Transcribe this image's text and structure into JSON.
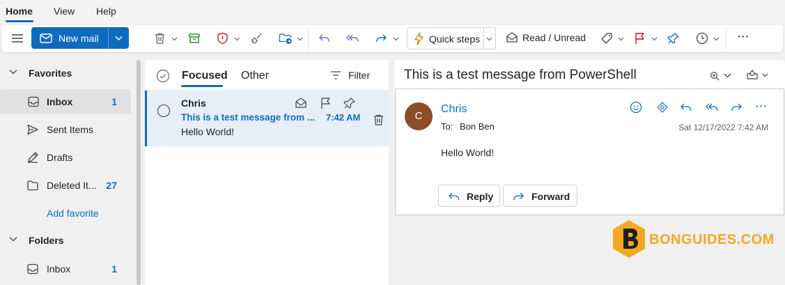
{
  "tabs": [
    "Home",
    "View",
    "Help"
  ],
  "ribbon": {
    "new_mail": "New mail",
    "quick_steps": "Quick steps",
    "read_unread": "Read / Unread",
    "more": "···"
  },
  "sidebar": {
    "favorites_label": "Favorites",
    "favorites": [
      {
        "label": "Inbox",
        "count": "1"
      },
      {
        "label": "Sent Items",
        "count": ""
      },
      {
        "label": "Drafts",
        "count": ""
      },
      {
        "label": "Deleted It...",
        "count": "27"
      }
    ],
    "add_favorite": "Add favorite",
    "folders_label": "Folders",
    "folders": [
      {
        "label": "Inbox",
        "count": "1"
      }
    ]
  },
  "list": {
    "tab_focused": "Focused",
    "tab_other": "Other",
    "filter_label": "Filter",
    "message": {
      "sender": "Chris",
      "subject": "This is a test message from ...",
      "time": "7:42 AM",
      "preview": "Hello World!"
    }
  },
  "reading": {
    "subject": "This is a test message from PowerShell",
    "avatar_initial": "C",
    "sender": "Chris",
    "to_label": "To:",
    "to": "Bon Ben",
    "date": "Sat 12/17/2022 7:42 AM",
    "body": "Hello World!",
    "reply_label": "Reply",
    "forward_label": "Forward"
  },
  "watermark": "BONGUIDES.COM",
  "colors": {
    "accent": "#0f6cbd",
    "avatar": "#8a4f28",
    "watermark_orange": "#f5a623",
    "flag_red": "#c50f1f",
    "reply_purple": "#8764b8",
    "archive_green": "#107c10"
  },
  "icons": {
    "hamburger": "hamburger-icon",
    "mail": "mail-icon",
    "delete": "trash-icon",
    "archive": "archive-icon",
    "report": "shield-icon",
    "sweep": "broom-icon",
    "move": "folder-move-icon",
    "reply": "reply-icon",
    "reply_all": "reply-all-icon",
    "forward": "forward-icon",
    "quick_steps": "lightning-icon",
    "read_unread": "envelope-open-icon",
    "tag": "tag-icon",
    "flag": "flag-icon",
    "pin": "pin-icon",
    "snooze": "clock-icon",
    "emoji": "smiley-icon",
    "teams": "teams-icon",
    "zoom": "zoom-icon",
    "immersive": "immersive-reader-icon"
  }
}
